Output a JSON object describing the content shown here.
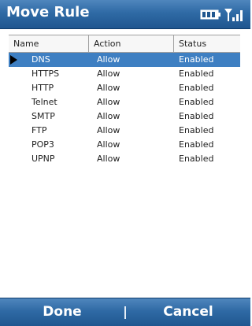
{
  "window": {
    "title": "Move Rule"
  },
  "status_icons": [
    "battery-icon",
    "signal-icon"
  ],
  "table": {
    "columns": [
      "Name",
      "Action",
      "Status"
    ],
    "rows": [
      {
        "name": "DNS",
        "action": "Allow",
        "status": "Enabled",
        "selected": true
      },
      {
        "name": "HTTPS",
        "action": "Allow",
        "status": "Enabled"
      },
      {
        "name": "HTTP",
        "action": "Allow",
        "status": "Enabled"
      },
      {
        "name": "Telnet",
        "action": "Allow",
        "status": "Enabled"
      },
      {
        "name": "SMTP",
        "action": "Allow",
        "status": "Enabled"
      },
      {
        "name": "FTP",
        "action": "Allow",
        "status": "Enabled"
      },
      {
        "name": "POP3",
        "action": "Allow",
        "status": "Enabled"
      },
      {
        "name": "UPNP",
        "action": "Allow",
        "status": "Enabled"
      }
    ]
  },
  "softkeys": {
    "left": "Done",
    "right": "Cancel"
  },
  "colors": {
    "accent": "#2f6aa5",
    "selection": "#3e7fc2"
  }
}
